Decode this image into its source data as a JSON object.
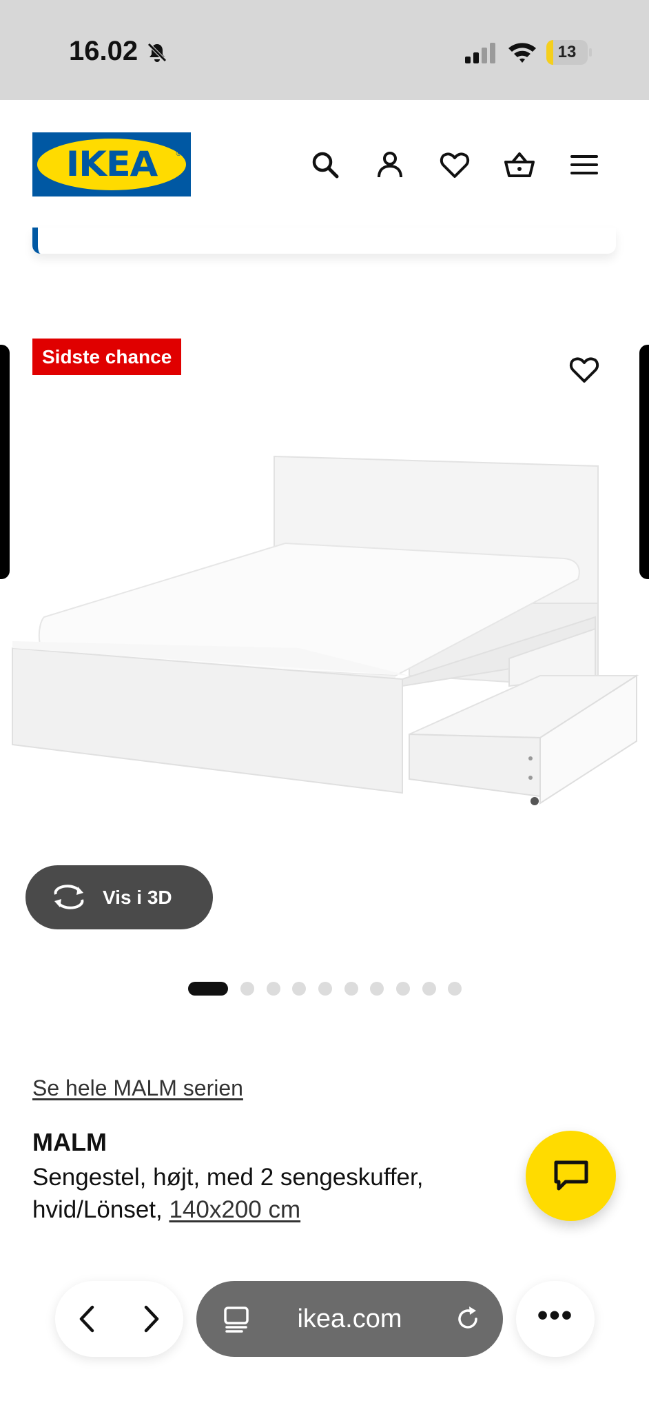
{
  "status_bar": {
    "time": "16.02",
    "battery": "13"
  },
  "header": {
    "logo_text": "IKEA",
    "icons": [
      "search-icon",
      "profile-icon",
      "heart-icon",
      "basket-icon",
      "menu-icon"
    ]
  },
  "product_image": {
    "badge": "Sidste chance",
    "view_3d_label": "Vis i 3D",
    "carousel_count": 10,
    "carousel_active_index": 0
  },
  "product": {
    "series_link": "Se hele MALM serien",
    "name": "MALM",
    "description": "Sengestel, højt, med 2 sengeskuffer, hvid/Lönset, ",
    "size": "140x200 cm"
  },
  "browser": {
    "url": "ikea.com"
  },
  "colors": {
    "ikea_blue": "#0058a3",
    "ikea_yellow": "#ffdb00",
    "badge_red": "#e00000",
    "status_bar_bg": "#d7d7d7"
  }
}
